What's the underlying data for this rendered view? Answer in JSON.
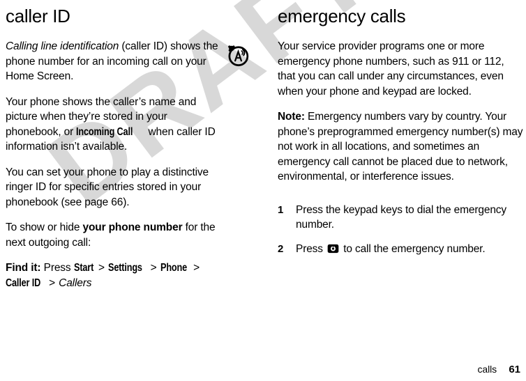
{
  "watermark": {
    "text": "DRAFT",
    "color": "#d8d8d8"
  },
  "footer": {
    "section": "calls",
    "page_number": "61"
  },
  "left_column": {
    "title": "caller ID",
    "margin_icon": "caller-id-antenna-icon",
    "paragraphs": {
      "p1_italic": "Calling line identification",
      "p1_rest": " (caller ID) shows the phone number for an incoming call on your Home Screen.",
      "p2_a": "Your phone shows the caller’s name and picture when they’re stored in your phonebook, or ",
      "p2_ui": "Incoming Call",
      "p2_b": " when caller ID information isn’t available.",
      "p3": "You can set your phone to play a distinctive ringer ID for specific entries stored in your phonebook (see page 66).",
      "p4_a": "To show or hide ",
      "p4_bold": "your phone number",
      "p4_b": " for the next outgoing call:"
    },
    "find_it": {
      "label": "Find it:",
      "press": "Press",
      "path": [
        "Start",
        "Settings",
        "Phone",
        "Caller ID"
      ],
      "separator": ">",
      "final_italic": "Callers"
    }
  },
  "right_column": {
    "title": "emergency calls",
    "paragraphs": {
      "p1": "Your service provider programs one or more emergency phone numbers, such as 911 or 112, that you can call under any circumstances, even when your phone and keypad are locked.",
      "note_label": "Note:",
      "note_body": " Emergency numbers vary by country. Your phone’s preprogrammed emergency number(s) may not work in all locations, and sometimes an emergency call cannot be placed due to network, environmental, or interference issues."
    },
    "steps": [
      {
        "number": "1",
        "text_before": "Press the keypad keys to dial the emergency number.",
        "key_icon": "",
        "text_after": ""
      },
      {
        "number": "2",
        "text_before": "Press ",
        "key_icon": "send-call-key-icon",
        "text_after": " to call the emergency number."
      }
    ]
  }
}
